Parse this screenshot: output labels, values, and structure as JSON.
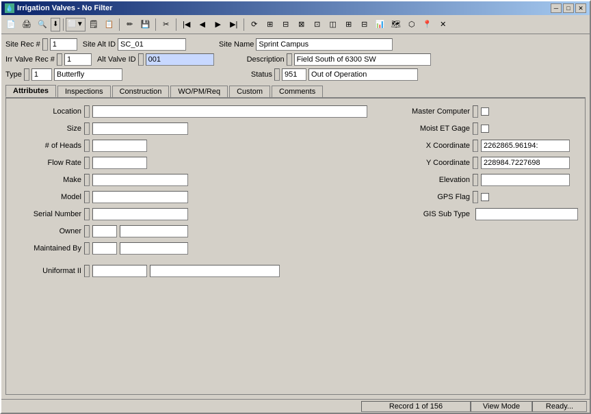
{
  "window": {
    "title": "Irrigation Valves - No Filter",
    "controls": {
      "minimize": "─",
      "maximize": "□",
      "close": "✕"
    }
  },
  "toolbar": {
    "buttons": [
      {
        "name": "print-btn",
        "icon": "🖨",
        "label": "Print"
      },
      {
        "name": "preview-btn",
        "icon": "🔍",
        "label": "Preview"
      },
      {
        "name": "filter-btn",
        "icon": "▼",
        "label": "Filter"
      },
      {
        "name": "layout-btn",
        "icon": "▦",
        "label": "Layout"
      }
    ]
  },
  "header_fields": {
    "site_rec_label": "Site Rec #",
    "site_rec_value": "1",
    "site_alt_id_label": "Site Alt ID",
    "site_alt_id_value": "SC_01",
    "site_name_label": "Site Name",
    "site_name_value": "Sprint Campus",
    "irr_valve_rec_label": "Irr Valve Rec #",
    "irr_valve_rec_value": "1",
    "alt_valve_id_label": "Alt Valve ID",
    "alt_valve_id_value": "001",
    "description_label": "Description",
    "description_value": "Field South of 6300 SW",
    "type_label": "Type",
    "type_code": "1",
    "type_value": "Butterfly",
    "status_label": "Status",
    "status_code": "951",
    "status_value": "Out of Operation"
  },
  "tabs": [
    {
      "id": "attributes",
      "label": "Attributes",
      "active": true
    },
    {
      "id": "inspections",
      "label": "Inspections"
    },
    {
      "id": "construction",
      "label": "Construction"
    },
    {
      "id": "wo-pm-req",
      "label": "WO/PM/Req"
    },
    {
      "id": "custom",
      "label": "Custom"
    },
    {
      "id": "comments",
      "label": "Comments"
    }
  ],
  "attributes": {
    "left": {
      "location_label": "Location",
      "location_value": "",
      "size_label": "Size",
      "size_value": "",
      "heads_label": "# of Heads",
      "heads_value": "",
      "flow_rate_label": "Flow Rate",
      "flow_rate_value": "",
      "make_label": "Make",
      "make_value": "",
      "model_label": "Model",
      "model_value": "",
      "serial_label": "Serial Number",
      "serial_value": "",
      "owner_label": "Owner",
      "owner_value": "",
      "owner_code": "",
      "maintained_label": "Maintained By",
      "maintained_value": "",
      "maintained_code": "",
      "uniformat_label": "Uniformat II",
      "uniformat_code": "",
      "uniformat_desc": ""
    },
    "right": {
      "master_computer_label": "Master Computer",
      "master_computer_checked": false,
      "moist_et_label": "Moist ET Gage",
      "moist_et_checked": false,
      "x_coord_label": "X Coordinate",
      "x_coord_value": "2262865.96194:",
      "y_coord_label": "Y Coordinate",
      "y_coord_value": "228984.7227698",
      "elevation_label": "Elevation",
      "elevation_value": "",
      "gps_flag_label": "GPS Flag",
      "gps_flag_checked": false,
      "gis_sub_type_label": "GIS Sub Type",
      "gis_sub_type_value": ""
    }
  },
  "status_bar": {
    "record_text": "Record 1 of 156",
    "mode_text": "View Mode",
    "ready_text": "Ready..."
  }
}
